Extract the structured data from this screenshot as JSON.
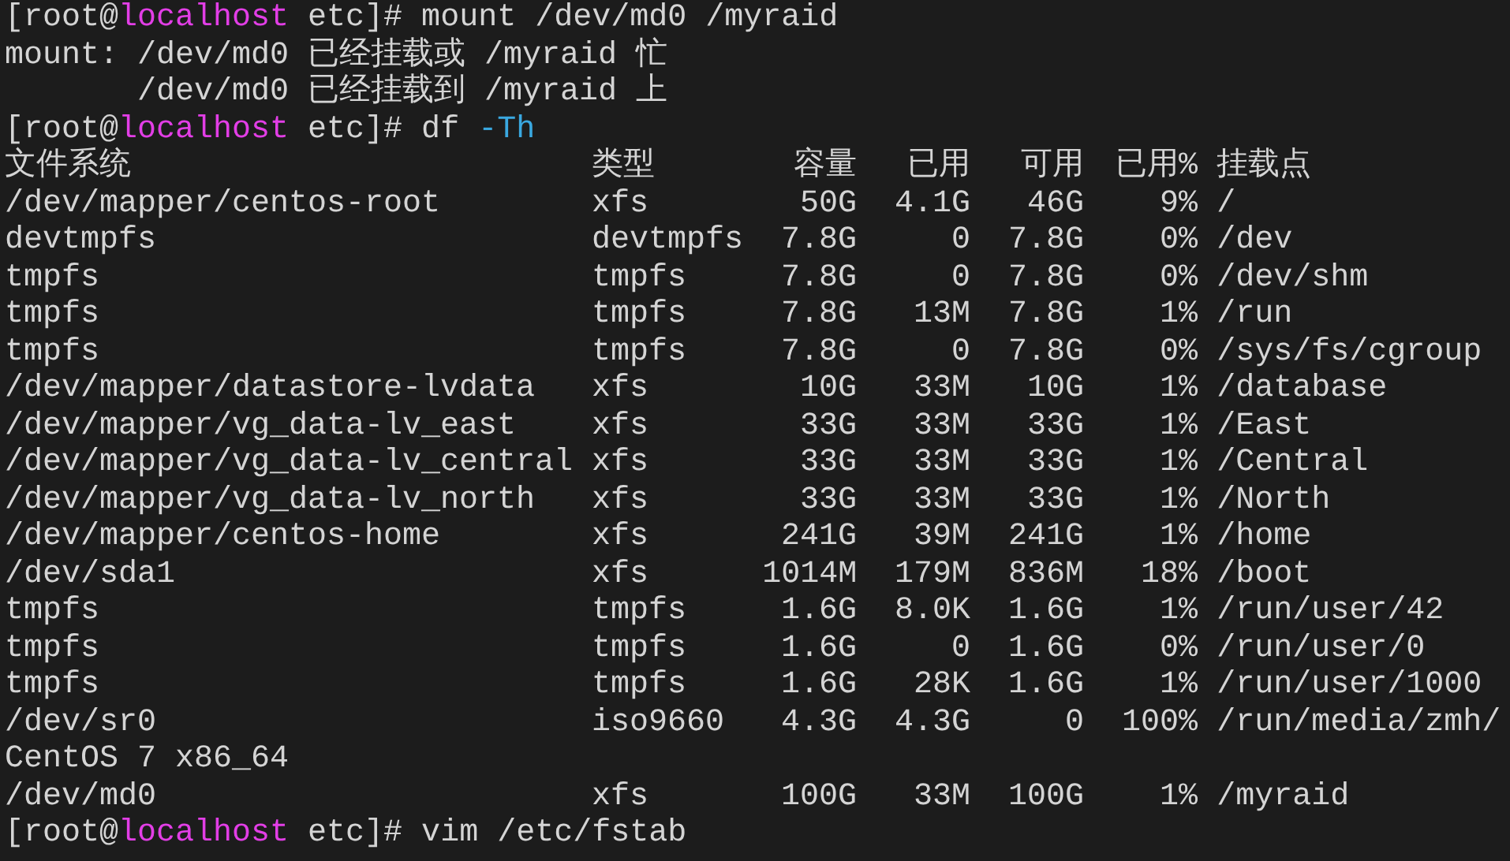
{
  "lines": [
    {
      "kind": "prompt",
      "segments": [
        {
          "kind": "plain",
          "text": "[root@"
        },
        {
          "kind": "host",
          "text": "localhost"
        },
        {
          "kind": "plain",
          "text": " etc]# mount /dev/md0 /myraid"
        }
      ]
    },
    {
      "kind": "text",
      "text": "mount: /dev/md0 已经挂载或 /myraid 忙"
    },
    {
      "kind": "text",
      "text": "       /dev/md0 已经挂载到 /myraid 上"
    },
    {
      "kind": "prompt",
      "segments": [
        {
          "kind": "plain",
          "text": "[root@"
        },
        {
          "kind": "host",
          "text": "localhost"
        },
        {
          "kind": "plain",
          "text": " etc]# df "
        },
        {
          "kind": "option",
          "text": "-Th"
        }
      ]
    },
    {
      "kind": "header",
      "cells": [
        "文件系统",
        "类型",
        "容量",
        "已用",
        "可用",
        "已用%",
        "挂载点"
      ]
    },
    {
      "kind": "row",
      "cells": [
        "/dev/mapper/centos-root",
        "xfs",
        "50G",
        "4.1G",
        "46G",
        "9%",
        "/"
      ]
    },
    {
      "kind": "row",
      "cells": [
        "devtmpfs",
        "devtmpfs",
        "7.8G",
        "0",
        "7.8G",
        "0%",
        "/dev"
      ]
    },
    {
      "kind": "row",
      "cells": [
        "tmpfs",
        "tmpfs",
        "7.8G",
        "0",
        "7.8G",
        "0%",
        "/dev/shm"
      ]
    },
    {
      "kind": "row",
      "cells": [
        "tmpfs",
        "tmpfs",
        "7.8G",
        "13M",
        "7.8G",
        "1%",
        "/run"
      ]
    },
    {
      "kind": "row",
      "cells": [
        "tmpfs",
        "tmpfs",
        "7.8G",
        "0",
        "7.8G",
        "0%",
        "/sys/fs/cgroup"
      ]
    },
    {
      "kind": "row",
      "cells": [
        "/dev/mapper/datastore-lvdata",
        "xfs",
        "10G",
        "33M",
        "10G",
        "1%",
        "/database"
      ]
    },
    {
      "kind": "row",
      "cells": [
        "/dev/mapper/vg_data-lv_east",
        "xfs",
        "33G",
        "33M",
        "33G",
        "1%",
        "/East"
      ]
    },
    {
      "kind": "row",
      "cells": [
        "/dev/mapper/vg_data-lv_central",
        "xfs",
        "33G",
        "33M",
        "33G",
        "1%",
        "/Central"
      ]
    },
    {
      "kind": "row",
      "cells": [
        "/dev/mapper/vg_data-lv_north",
        "xfs",
        "33G",
        "33M",
        "33G",
        "1%",
        "/North"
      ]
    },
    {
      "kind": "row",
      "cells": [
        "/dev/mapper/centos-home",
        "xfs",
        "241G",
        "39M",
        "241G",
        "1%",
        "/home"
      ]
    },
    {
      "kind": "row",
      "cells": [
        "/dev/sda1",
        "xfs",
        "1014M",
        "179M",
        "836M",
        "18%",
        "/boot"
      ]
    },
    {
      "kind": "row",
      "cells": [
        "tmpfs",
        "tmpfs",
        "1.6G",
        "8.0K",
        "1.6G",
        "1%",
        "/run/user/42"
      ]
    },
    {
      "kind": "row",
      "cells": [
        "tmpfs",
        "tmpfs",
        "1.6G",
        "0",
        "1.6G",
        "0%",
        "/run/user/0"
      ]
    },
    {
      "kind": "row",
      "cells": [
        "tmpfs",
        "tmpfs",
        "1.6G",
        "28K",
        "1.6G",
        "1%",
        "/run/user/1000"
      ]
    },
    {
      "kind": "row",
      "cells": [
        "/dev/sr0",
        "iso9660",
        "4.3G",
        "4.3G",
        "0",
        "100%",
        "/run/media/zmh/"
      ]
    },
    {
      "kind": "text",
      "text": "CentOS 7 x86_64"
    },
    {
      "kind": "row",
      "cells": [
        "/dev/md0",
        "xfs",
        "100G",
        "33M",
        "100G",
        "1%",
        "/myraid"
      ]
    },
    {
      "kind": "prompt",
      "segments": [
        {
          "kind": "plain",
          "text": "[root@"
        },
        {
          "kind": "host",
          "text": "localhost"
        },
        {
          "kind": "plain",
          "text": " etc]# vim /etc/fstab"
        }
      ]
    }
  ]
}
